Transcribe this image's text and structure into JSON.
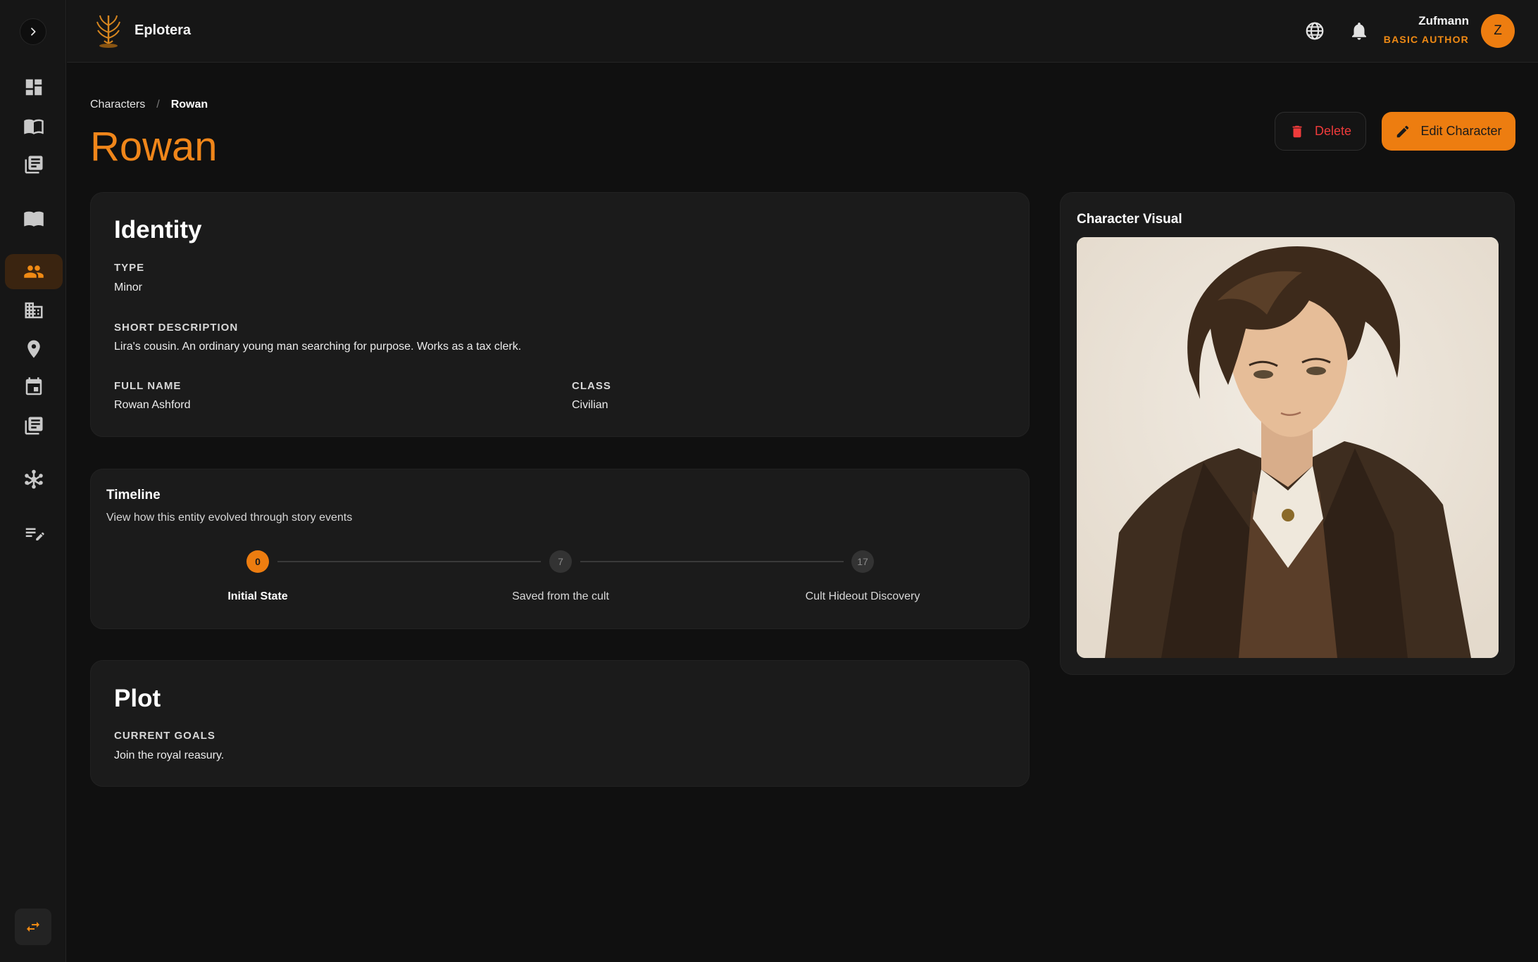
{
  "app": {
    "name": "Eplotera"
  },
  "user": {
    "name": "Zufmann",
    "role": "BASIC AUTHOR",
    "initial": "Z"
  },
  "breadcrumb": {
    "parent": "Characters",
    "separator": "/",
    "current": "Rowan"
  },
  "page": {
    "title": "Rowan"
  },
  "actions": {
    "delete_label": "Delete",
    "edit_label": "Edit Character"
  },
  "identity": {
    "heading": "Identity",
    "type_label": "TYPE",
    "type_value": "Minor",
    "short_desc_label": "SHORT DESCRIPTION",
    "short_desc_value": "Lira's cousin. An ordinary young man searching for purpose. Works as a tax clerk.",
    "full_name_label": "FULL NAME",
    "full_name_value": "Rowan Ashford",
    "class_label": "CLASS",
    "class_value": "Civilian"
  },
  "timeline": {
    "heading": "Timeline",
    "subtitle": "View how this entity evolved through story events",
    "events": [
      {
        "number": "0",
        "label": "Initial State",
        "active": true
      },
      {
        "number": "7",
        "label": "Saved from the cult",
        "active": false
      },
      {
        "number": "17",
        "label": "Cult Hideout Discovery",
        "active": false
      }
    ]
  },
  "plot": {
    "heading": "Plot",
    "goals_label": "CURRENT GOALS",
    "goals_value": "Join the royal reasury."
  },
  "visual": {
    "heading": "Character Visual"
  },
  "colors": {
    "accent": "#ed7d10",
    "danger": "#ef3b3b",
    "background": "#101010",
    "card": "#1b1b1b"
  },
  "icons": {
    "sidebar": [
      "dashboard-icon",
      "book-open-icon",
      "library-icon",
      "book-icon",
      "people-icon",
      "building-icon",
      "location-pin-icon",
      "calendar-icon",
      "library-icon",
      "network-icon",
      "edit-list-icon",
      "swap-icon"
    ],
    "header": [
      "globe-icon",
      "bell-icon"
    ]
  }
}
